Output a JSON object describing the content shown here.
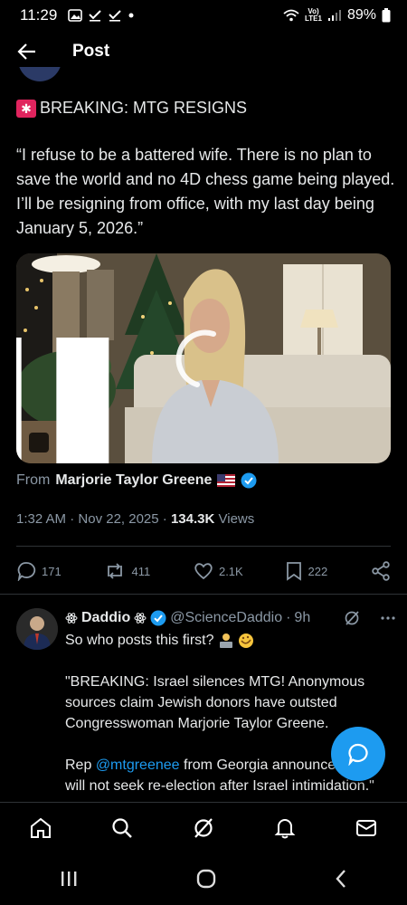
{
  "status_bar": {
    "time": "11:29",
    "network_top": "Vo)",
    "network_bottom": "LTE1",
    "battery": "89%"
  },
  "top_bar": {
    "title": "Post"
  },
  "post": {
    "headline": "BREAKING: MTG RESIGNS",
    "quote": "“I refuse to be a battered wife. There is no plan to save the world and no 4D chess game being played. I’ll be resigning from office, with my last day being January 5, 2026.”",
    "media": {
      "type": "video",
      "state": "loading"
    },
    "from_prefix": "From",
    "from_name": "Marjorie Taylor Greene",
    "time": "1:32 AM",
    "date": "Nov 22, 2025",
    "views_count": "134.3K",
    "views_label": "Views",
    "stats": {
      "replies": "171",
      "reposts": "411",
      "likes": "2.1K",
      "bookmarks": "222"
    }
  },
  "reply": {
    "name": "Daddio",
    "handle": "@ScienceDaddio",
    "age": "9h",
    "line1": "So who posts this first?",
    "para2": "\"BREAKING: Israel silences MTG! Anonymous sources claim Jewish donors have outsted Congresswoman Marjorie Taylor Greene.",
    "para3_prefix": "Rep",
    "para3_mention": "@mtgreenee",
    "para3_suffix": "from Georgia announced she will not seek re-election after Israel intimidation.\""
  },
  "colors": {
    "background": "#000000",
    "accent": "#1d9bf0",
    "text": "#e7e9ea",
    "muted": "#8b98a5",
    "divider": "#2f3336"
  },
  "icons": {
    "back": "arrow-left-icon",
    "reply": "comment-icon",
    "repost": "repost-icon",
    "like": "heart-icon",
    "bookmark": "bookmark-icon",
    "share": "share-icon",
    "nav": [
      "home-icon",
      "search-icon",
      "grok-icon",
      "notifications-icon",
      "messages-icon"
    ],
    "system": [
      "recents-icon",
      "home-circle-icon",
      "back-chevron-icon"
    ]
  }
}
